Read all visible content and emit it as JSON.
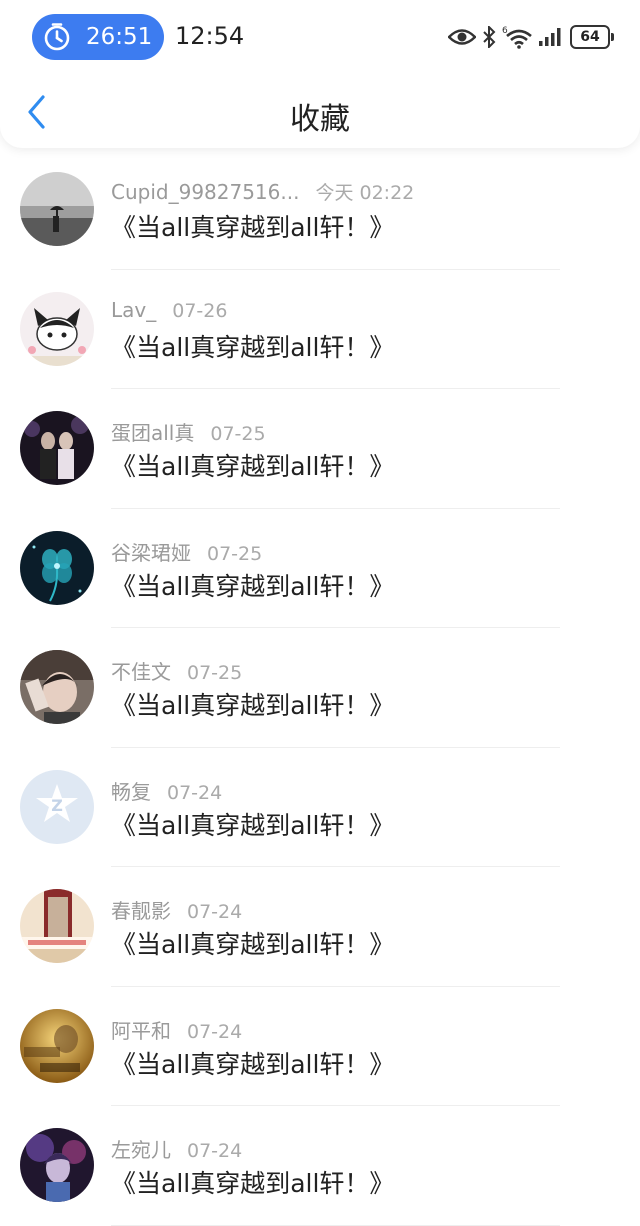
{
  "status_bar": {
    "timer": "26:51",
    "clock": "12:54",
    "battery": "64",
    "icons": [
      "timer-icon",
      "eye-icon",
      "bluetooth-icon",
      "wifi-icon",
      "signal-icon",
      "battery-icon"
    ]
  },
  "header": {
    "title": "收藏",
    "back_icon": "chevron-left-icon"
  },
  "favorites": [
    {
      "user": "Cupid_99827516...",
      "time": "今天 02:22",
      "content": "《当all真穿越到all轩！》"
    },
    {
      "user": "Lav_",
      "time": "07-26",
      "content": "《当all真穿越到all轩！》"
    },
    {
      "user": "蛋团all真",
      "time": "07-25",
      "content": "《当all真穿越到all轩！》"
    },
    {
      "user": "谷梁珺娅",
      "time": "07-25",
      "content": "《当all真穿越到all轩！》"
    },
    {
      "user": "不佳文",
      "time": "07-25",
      "content": "《当all真穿越到all轩！》"
    },
    {
      "user": "畅复",
      "time": "07-24",
      "content": "《当all真穿越到all轩！》"
    },
    {
      "user": "春靓影",
      "time": "07-24",
      "content": "《当all真穿越到all轩！》"
    },
    {
      "user": "阿平和",
      "time": "07-24",
      "content": "《当all真穿越到all轩！》"
    },
    {
      "user": "左宛儿",
      "time": "07-24",
      "content": "《当all真穿越到all轩！》"
    }
  ],
  "colors": {
    "accent": "#3d7cf0",
    "back_arrow": "#2f8cf0",
    "meta_text": "#9a9a9a"
  }
}
